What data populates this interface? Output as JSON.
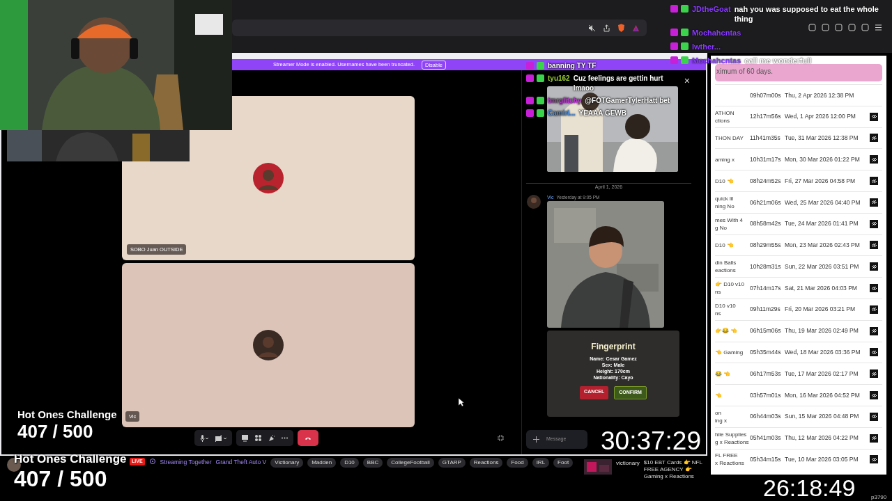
{
  "streamer_banner": {
    "text": "Streamer Mode is enabled. Usernames have been truncated.",
    "button": "Disable"
  },
  "call": {
    "tiles": [
      {
        "label": "SOBO Juan OUTSIDE",
        "kind": "tile"
      },
      {
        "label": "Vic",
        "kind": "tile"
      }
    ]
  },
  "chat_panel": {
    "close": "×",
    "date_divider": "April 1, 2026",
    "author": "Vic",
    "time": "Yesterday at 9:05 PM",
    "fingerprint": {
      "title": "Fingerprint",
      "lines": [
        "Name: Cesar Gamez",
        "Sex: Male",
        "Height: 170cm",
        "Nationality: Cayo"
      ],
      "cancel": "CANCEL",
      "confirm": "CONFIRM"
    },
    "input_placeholder": "Message"
  },
  "vods": {
    "notice": "ximum of 60 days.",
    "rows": [
      {
        "title": "",
        "duration": "09h07m00s",
        "date": "Thu, 2 Apr 2026 12:38 PM",
        "link": false
      },
      {
        "title": "ATHON\nctions",
        "duration": "12h17m56s",
        "date": "Wed, 1 Apr 2026 12:00 PM",
        "link": true
      },
      {
        "title": "THON DAY",
        "duration": "11h41m35s",
        "date": "Tue, 31 Mar 2026 12:38 PM",
        "link": true
      },
      {
        "title": "aming x",
        "duration": "10h31m17s",
        "date": "Mon, 30 Mar 2026 01:22 PM",
        "link": true
      },
      {
        "title": "D10 👈",
        "duration": "08h24m52s",
        "date": "Fri, 27 Mar 2026 04:58 PM",
        "link": true
      },
      {
        "title": "quick lil\nning No",
        "duration": "06h21m06s",
        "date": "Wed, 25 Mar 2026 04:40 PM",
        "link": true
      },
      {
        "title": "mes With 4\ng No",
        "duration": "08h58m42s",
        "date": "Tue, 24 Mar 2026 01:41 PM",
        "link": true
      },
      {
        "title": "D10 👈",
        "duration": "08h29m55s",
        "date": "Mon, 23 Mar 2026 02:43 PM",
        "link": true
      },
      {
        "title": "din Balls\neactions",
        "duration": "10h28m31s",
        "date": "Sun, 22 Mar 2026 03:51 PM",
        "link": true
      },
      {
        "title": "👉 D10 v10\nns",
        "duration": "07h14m17s",
        "date": "Sat, 21 Mar 2026 04:03 PM",
        "link": true
      },
      {
        "title": "D10 v10\nns",
        "duration": "09h11m29s",
        "date": "Fri, 20 Mar 2026 03:21 PM",
        "link": true
      },
      {
        "title": "👉😂 👈",
        "duration": "06h15m06s",
        "date": "Thu, 19 Mar 2026 02:49 PM",
        "link": true
      },
      {
        "title": "👈 Gaming",
        "duration": "05h35m44s",
        "date": "Wed, 18 Mar 2026 03:36 PM",
        "link": true
      },
      {
        "title": "😂 👈",
        "duration": "06h17m53s",
        "date": "Tue, 17 Mar 2026 02:17 PM",
        "link": true
      },
      {
        "title": "👈",
        "duration": "03h57m01s",
        "date": "Mon, 16 Mar 2026 04:52 PM",
        "link": true
      },
      {
        "title": "on\ning x",
        "duration": "06h44m03s",
        "date": "Sun, 15 Mar 2026 04:48 PM",
        "link": true
      },
      {
        "title": "hile Supplies\ng x Reactions",
        "duration": "05h41m03s",
        "date": "Thu, 12 Mar 2026 04:22 PM",
        "link": true
      },
      {
        "title": "FL FREE\nx Reactions",
        "duration": "05h34m15s",
        "date": "Tue, 10 Mar 2026 03:05 PM",
        "link": true
      }
    ]
  },
  "stream_bar": {
    "live": "LIVE",
    "activity": "Streaming Together",
    "game": "Grand Theft Auto V",
    "tags": [
      "Victionary",
      "Madden",
      "D10",
      "BBC",
      "CollegeFootball",
      "GTARP",
      "Reactions",
      "Food",
      "IRL",
      "Foot"
    ],
    "card": {
      "channel": "victionary",
      "title": "$10 EBT Cards 👉 NFL FREE AGENCY 👉 Gaming x Reactions"
    }
  },
  "overlay": {
    "counters": [
      {
        "title": "Hot Ones Challenge",
        "count": "407 / 500"
      },
      {
        "title": "Hot Ones Challenge",
        "count": "407 / 500"
      }
    ],
    "timers": [
      "30:37:29",
      "26:18:49"
    ],
    "tag": "p3790",
    "chat_right": [
      {
        "user": "JDtheGoat",
        "color": "#8a3cff",
        "text": "nah you was supposed to eat the whole thing"
      },
      {
        "user": "Mochahcntas",
        "color": "#8a3cff"
      },
      {
        "user": "lwther...",
        "color": "#8a3cff"
      },
      {
        "user": "Mochahcntas",
        "color": "#8a3cff",
        "text": "call me wonderfull"
      }
    ],
    "chat_left": [
      {
        "text": "banning TY TF"
      },
      {
        "user": "tyu162",
        "color": "#9acd32",
        "text": "Cuz feelings are gettin hurt lmaoo"
      },
      {
        "user": "tmrglitchy",
        "color": "#c03ad6",
        "text": "@FOTGamerTylerHatt bet"
      },
      {
        "user": "Camiri...",
        "color": "#4d8fe0",
        "text": "YEAAA GEWB"
      }
    ]
  }
}
